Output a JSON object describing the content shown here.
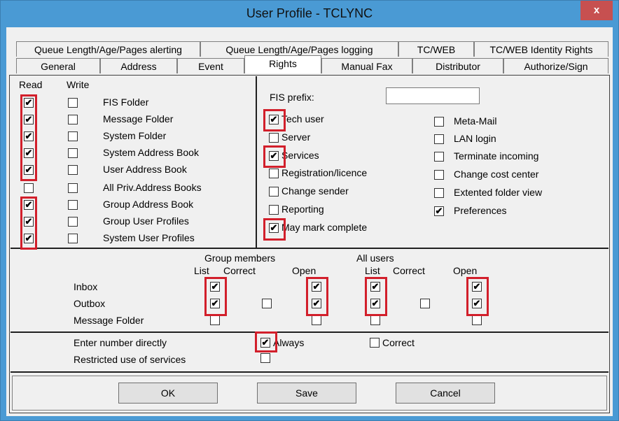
{
  "window": {
    "title": "User Profile - TCLYNC",
    "close_glyph": "x"
  },
  "tabs_row1": [
    "Queue Length/Age/Pages alerting",
    "Queue Length/Age/Pages logging",
    "TC/WEB",
    "TC/WEB Identity Rights"
  ],
  "tabs_row2": [
    "General",
    "Address",
    "Event",
    "Rights",
    "Manual Fax",
    "Distributor",
    "Authorize/Sign"
  ],
  "folders": {
    "read_header": "Read",
    "write_header": "Write",
    "rows": [
      {
        "label": "FIS Folder",
        "read": true,
        "write": false
      },
      {
        "label": "Message Folder",
        "read": true,
        "write": false
      },
      {
        "label": "System Folder",
        "read": true,
        "write": false
      },
      {
        "label": "System Address Book",
        "read": true,
        "write": false
      },
      {
        "label": "User Address Book",
        "read": true,
        "write": false
      },
      {
        "label": "All Priv.Address Books",
        "read": false,
        "write": false
      },
      {
        "label": "Group Address Book",
        "read": true,
        "write": false
      },
      {
        "label": "Group User Profiles",
        "read": true,
        "write": false
      },
      {
        "label": "System User Profiles",
        "read": true,
        "write": false
      }
    ]
  },
  "rights": {
    "fis_prefix_label": "FIS prefix:",
    "fis_prefix_value": "",
    "left": [
      {
        "label": "Tech user",
        "checked": true
      },
      {
        "label": "Server",
        "checked": false
      },
      {
        "label": "Services",
        "checked": true
      },
      {
        "label": "Registration/licence",
        "checked": false
      },
      {
        "label": "Change sender",
        "checked": false
      },
      {
        "label": "Reporting",
        "checked": false
      },
      {
        "label": "May mark complete",
        "checked": true
      }
    ],
    "right": [
      {
        "label": "Meta-Mail",
        "checked": false
      },
      {
        "label": "LAN login",
        "checked": false
      },
      {
        "label": "Terminate incoming",
        "checked": false
      },
      {
        "label": "Change cost center",
        "checked": false
      },
      {
        "label": "Extented folder view",
        "checked": false
      },
      {
        "label": "Preferences",
        "checked": true
      }
    ]
  },
  "boxes": {
    "group_members_label": "Group members",
    "all_users_label": "All users",
    "col_list": "List",
    "col_correct": "Correct",
    "col_open": "Open",
    "rows": [
      {
        "label": "Inbox",
        "gm_list": true,
        "gm_open": true,
        "au_list": true,
        "au_open": true
      },
      {
        "label": "Outbox",
        "gm_list": true,
        "gm_correct": false,
        "gm_open": true,
        "au_list": true,
        "au_correct": false,
        "au_open": true
      },
      {
        "label": "Message Folder",
        "gm_list": false,
        "gm_open": false,
        "au_list": false,
        "au_open": false
      }
    ]
  },
  "number": {
    "enter_label": "Enter number directly",
    "always_label": "Always",
    "always_checked": true,
    "correct_label": "Correct",
    "correct_checked": false,
    "restricted_label": "Restricted use of services",
    "restricted_checked": false
  },
  "buttons": {
    "ok": "OK",
    "save": "Save",
    "cancel": "Cancel"
  },
  "glyphs": {
    "check": "✔"
  },
  "colors": {
    "highlight": "#d21f2b",
    "title_bg": "#4a9ad4",
    "close_bg": "#c75050"
  }
}
